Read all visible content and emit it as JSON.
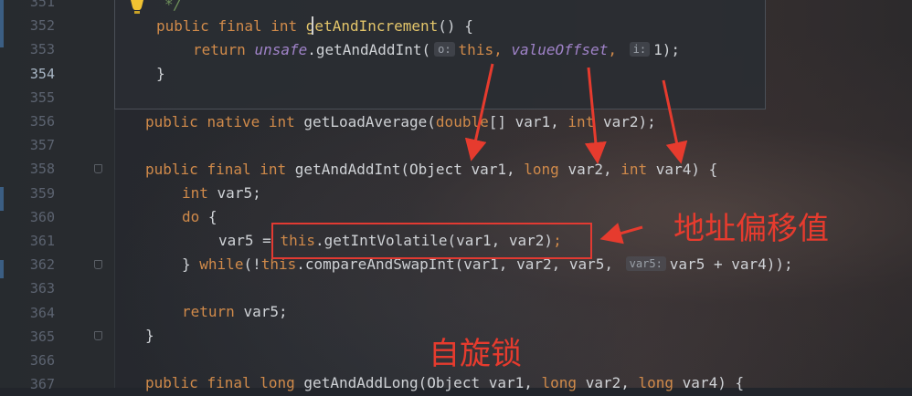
{
  "editor": {
    "line_numbers": [
      "351",
      "352",
      "353",
      "354",
      "355",
      "356",
      "357",
      "358",
      "359",
      "360",
      "361",
      "362",
      "363",
      "364",
      "365",
      "366",
      "367"
    ],
    "current_line": "354"
  },
  "quick_doc": {
    "comment_end": "*/",
    "line1": {
      "kw1": "public",
      "kw2": "final",
      "kw3": "int",
      "fn": "getAndIncrement",
      "rest": "() {"
    },
    "line2": {
      "kw": "return",
      "field": "unsafe",
      "call": ".getAndAddInt(",
      "hint_o": "o:",
      "this": "this",
      "comma1": ",",
      "field2": "valueOffset",
      "comma2": ",",
      "hint_i": "i:",
      "arg": "1);"
    },
    "line3": {
      "text": "}"
    }
  },
  "code": {
    "l356": {
      "kw1": "public",
      "kw2": "native",
      "kw3": "int",
      "sig": "getLoadAverage(",
      "kw4": "double",
      "mid": "[] var1,",
      "kw5": "int",
      "end": "var2);"
    },
    "l358": {
      "kw1": "public",
      "kw2": "final",
      "kw3": "int",
      "sig": "getAndAddInt(Object var1,",
      "kw4": "long",
      "mid": "var2,",
      "kw5": "int",
      "end": "var4) {"
    },
    "l359": {
      "kw": "int",
      "rest": "var5;"
    },
    "l360": {
      "kw": "do",
      "rest": "{"
    },
    "l361": {
      "pre": "var5 =",
      "this": "this",
      "call": ".getIntVolatile(var1, var2)",
      "semi": ";"
    },
    "l362": {
      "brace": "}",
      "kw": "while",
      "open": "(!",
      "this": "this",
      "call": ".compareAndSwapInt(var1, var2, var5,",
      "hint": "var5:",
      "end": "var5 + var4));"
    },
    "l364": {
      "kw": "return",
      "rest": "var5;"
    },
    "l365": {
      "text": "}"
    },
    "l367": {
      "kw1": "public",
      "kw2": "final",
      "kw3": "long",
      "sig": "getAndAddLong(Object var1,",
      "kw4": "long",
      "mid": "var2,",
      "kw5": "long",
      "end": "var4) {"
    }
  },
  "annotations": {
    "offset_label": "地址偏移值",
    "spin_label": "自旋锁",
    "color": "#e63b2e"
  }
}
